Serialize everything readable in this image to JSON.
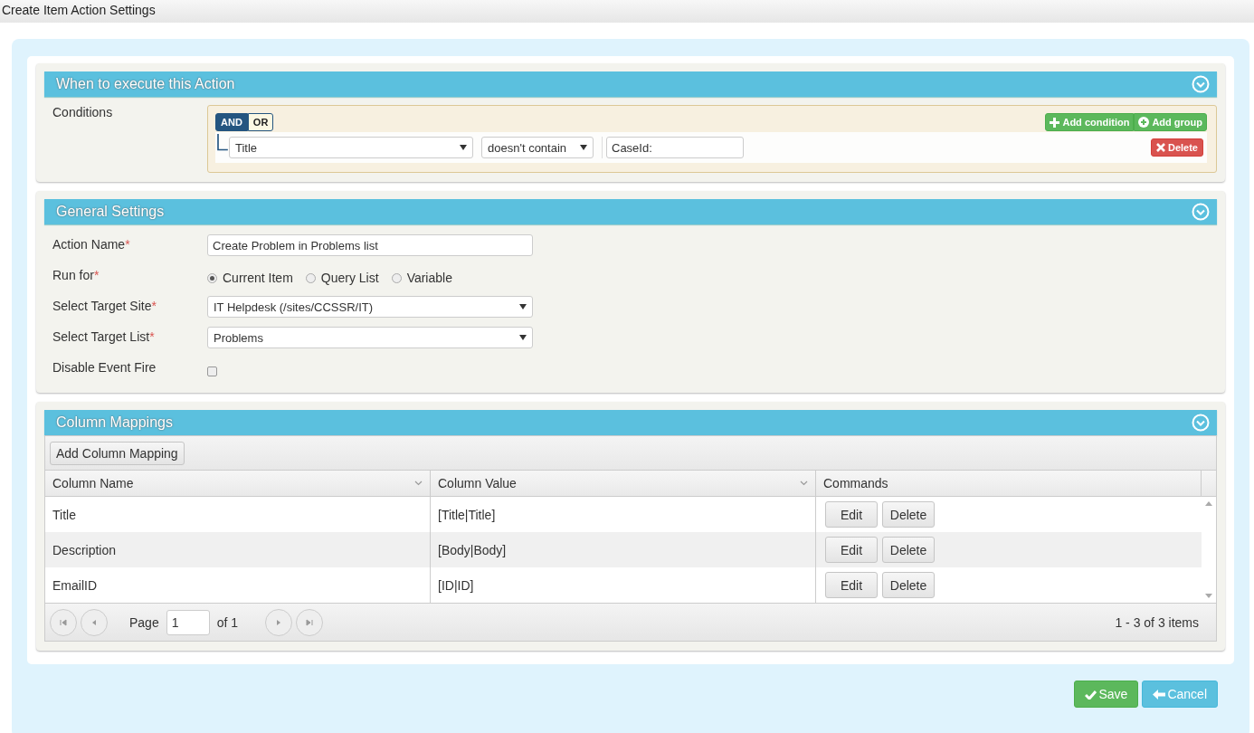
{
  "window": {
    "title": "Create Item Action Settings"
  },
  "conditions_section": {
    "title": "When to execute this Action",
    "label": "Conditions",
    "logic": [
      {
        "label": "AND",
        "selected": true
      },
      {
        "label": "OR",
        "selected": false
      }
    ],
    "actions": [
      {
        "kind": "plus",
        "label": "Add condition"
      },
      {
        "kind": "plus-circle",
        "label": "Add group"
      }
    ],
    "rules": [
      {
        "field": "Title",
        "operator": "doesn't contain",
        "value": "CaseId:",
        "delete": "Delete"
      }
    ]
  },
  "general_section": {
    "title": "General Settings",
    "fields": [
      {
        "kind": "text",
        "label": "Action Name",
        "required_mark": "*",
        "value": "Create Problem in Problems list"
      },
      {
        "kind": "radio",
        "label": "Run for",
        "required_mark": "*",
        "options": [
          {
            "label": "Current Item",
            "selected": true
          },
          {
            "label": "Query List",
            "selected": false
          },
          {
            "label": "Variable",
            "selected": false
          }
        ]
      },
      {
        "kind": "select",
        "label": "Select Target Site",
        "required_mark": "*",
        "value": "IT Helpdesk (/sites/CCSSR/IT)"
      },
      {
        "kind": "select",
        "label": "Select Target List",
        "required_mark": "*",
        "value": "Problems"
      },
      {
        "kind": "checkbox",
        "label": "Disable Event Fire",
        "checked": false
      }
    ]
  },
  "mappings_section": {
    "title": "Column Mappings",
    "add_button": "Add Column Mapping",
    "columns": [
      {
        "label": "Column Name",
        "menu": true
      },
      {
        "label": "Column Value",
        "menu": true
      },
      {
        "label": "Commands",
        "menu": false
      }
    ],
    "rows": [
      {
        "name": "Title",
        "value": "[Title|Title]",
        "commands": [
          "Edit",
          "Delete"
        ]
      },
      {
        "name": "Description",
        "value": "[Body|Body]",
        "commands": [
          "Edit",
          "Delete"
        ]
      },
      {
        "name": "EmailID",
        "value": "[ID|ID]",
        "commands": [
          "Edit",
          "Delete"
        ]
      }
    ],
    "pager": {
      "page_label": "Page",
      "page": "1",
      "of": "of 1",
      "summary": "1 - 3 of 3 items"
    }
  },
  "footer_buttons": [
    {
      "kind": "save",
      "label": "Save"
    },
    {
      "kind": "cancel",
      "label": "Cancel"
    }
  ]
}
